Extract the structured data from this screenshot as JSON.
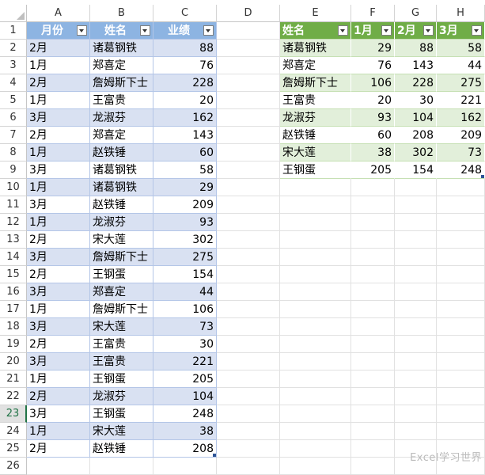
{
  "columns": [
    "A",
    "B",
    "C",
    "D",
    "E",
    "F",
    "G",
    "H"
  ],
  "rows": [
    "1",
    "2",
    "3",
    "4",
    "5",
    "6",
    "7",
    "8",
    "9",
    "10",
    "11",
    "12",
    "13",
    "14",
    "15",
    "16",
    "17",
    "18",
    "19",
    "20",
    "21",
    "22",
    "23",
    "24",
    "25",
    "26"
  ],
  "selected_row": "23",
  "left_table": {
    "headers": [
      "月份",
      "姓名",
      "业绩"
    ],
    "rows": [
      [
        "2月",
        "诸葛钢铁",
        "88"
      ],
      [
        "1月",
        "郑喜定",
        "76"
      ],
      [
        "2月",
        "詹姆斯下士",
        "228"
      ],
      [
        "1月",
        "王富贵",
        "20"
      ],
      [
        "3月",
        "龙淑芬",
        "162"
      ],
      [
        "2月",
        "郑喜定",
        "143"
      ],
      [
        "1月",
        "赵铁锤",
        "60"
      ],
      [
        "3月",
        "诸葛钢铁",
        "58"
      ],
      [
        "1月",
        "诸葛钢铁",
        "29"
      ],
      [
        "3月",
        "赵铁锤",
        "209"
      ],
      [
        "1月",
        "龙淑芬",
        "93"
      ],
      [
        "2月",
        "宋大莲",
        "302"
      ],
      [
        "3月",
        "詹姆斯下士",
        "275"
      ],
      [
        "2月",
        "王钢蛋",
        "154"
      ],
      [
        "3月",
        "郑喜定",
        "44"
      ],
      [
        "1月",
        "詹姆斯下士",
        "106"
      ],
      [
        "3月",
        "宋大莲",
        "73"
      ],
      [
        "2月",
        "王富贵",
        "30"
      ],
      [
        "3月",
        "王富贵",
        "221"
      ],
      [
        "1月",
        "王钢蛋",
        "205"
      ],
      [
        "2月",
        "龙淑芬",
        "104"
      ],
      [
        "3月",
        "王钢蛋",
        "248"
      ],
      [
        "1月",
        "宋大莲",
        "38"
      ],
      [
        "2月",
        "赵铁锤",
        "208"
      ]
    ]
  },
  "right_table": {
    "headers": [
      "姓名",
      "1月",
      "2月",
      "3月"
    ],
    "rows": [
      [
        "诸葛钢铁",
        "29",
        "88",
        "58"
      ],
      [
        "郑喜定",
        "76",
        "143",
        "44"
      ],
      [
        "詹姆斯下士",
        "106",
        "228",
        "275"
      ],
      [
        "王富贵",
        "20",
        "30",
        "221"
      ],
      [
        "龙淑芬",
        "93",
        "104",
        "162"
      ],
      [
        "赵铁锤",
        "60",
        "208",
        "209"
      ],
      [
        "宋大莲",
        "38",
        "302",
        "73"
      ],
      [
        "王钢蛋",
        "205",
        "154",
        "248"
      ]
    ]
  },
  "watermark": "Excel学习世界",
  "colors": {
    "blue_header": "#8db4e2",
    "blue_band": "#d9e1f2",
    "green_header": "#70ad47",
    "green_band": "#e2efda"
  }
}
